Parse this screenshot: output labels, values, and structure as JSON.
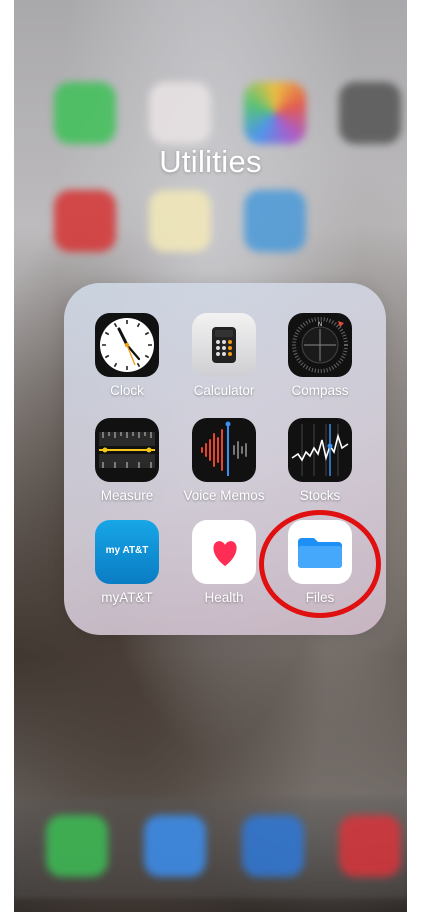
{
  "folder": {
    "title": "Utilities"
  },
  "apps": [
    {
      "label": "Clock"
    },
    {
      "label": "Calculator"
    },
    {
      "label": "Compass"
    },
    {
      "label": "Measure"
    },
    {
      "label": "Voice Memos"
    },
    {
      "label": "Stocks"
    },
    {
      "label": "myAT&T",
      "tile_text": "my AT&T"
    },
    {
      "label": "Health"
    },
    {
      "label": "Files"
    }
  ],
  "colors": {
    "highlight": "#e01010",
    "folder_blue": "#1e8ff5",
    "att_blue": "#0d8fd6",
    "health_red": "#ff2d55"
  }
}
